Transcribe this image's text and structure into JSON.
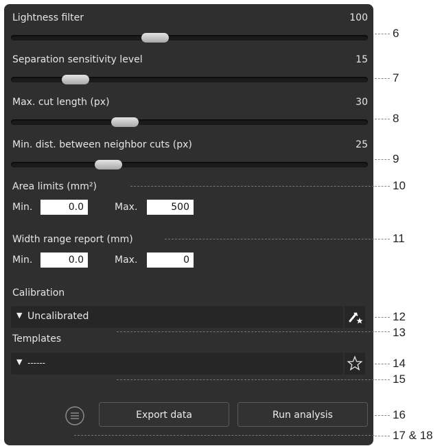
{
  "sliders": [
    {
      "label": "Lightness filter",
      "value": "100"
    },
    {
      "label": "Separation sensitivity level",
      "value": "15"
    },
    {
      "label": "Max. cut length (px)",
      "value": "30"
    },
    {
      "label": "Min. dist. between neighbor cuts (px)",
      "value": "25"
    }
  ],
  "area": {
    "label": "Area limits (mm²)",
    "min_label": "Min.",
    "min_value": "0.0",
    "max_label": "Max.",
    "max_value": "500"
  },
  "width": {
    "label": "Width range report (mm)",
    "min_label": "Min.",
    "min_value": "0.0",
    "max_label": "Max.",
    "max_value": "0"
  },
  "calibration": {
    "label": "Calibration",
    "selected": "Uncalibrated",
    "icon": "calibrate-wand-icon"
  },
  "templates": {
    "label": "Templates",
    "selected": "------",
    "icon": "star-icon"
  },
  "footer": {
    "menu_icon": "menu-icon",
    "export_label": "Export data",
    "run_label": "Run analysis"
  },
  "callouts": [
    "6",
    "7",
    "8",
    "9",
    "10",
    "11",
    "12",
    "13",
    "14",
    "15",
    "16",
    "17 & 18"
  ]
}
